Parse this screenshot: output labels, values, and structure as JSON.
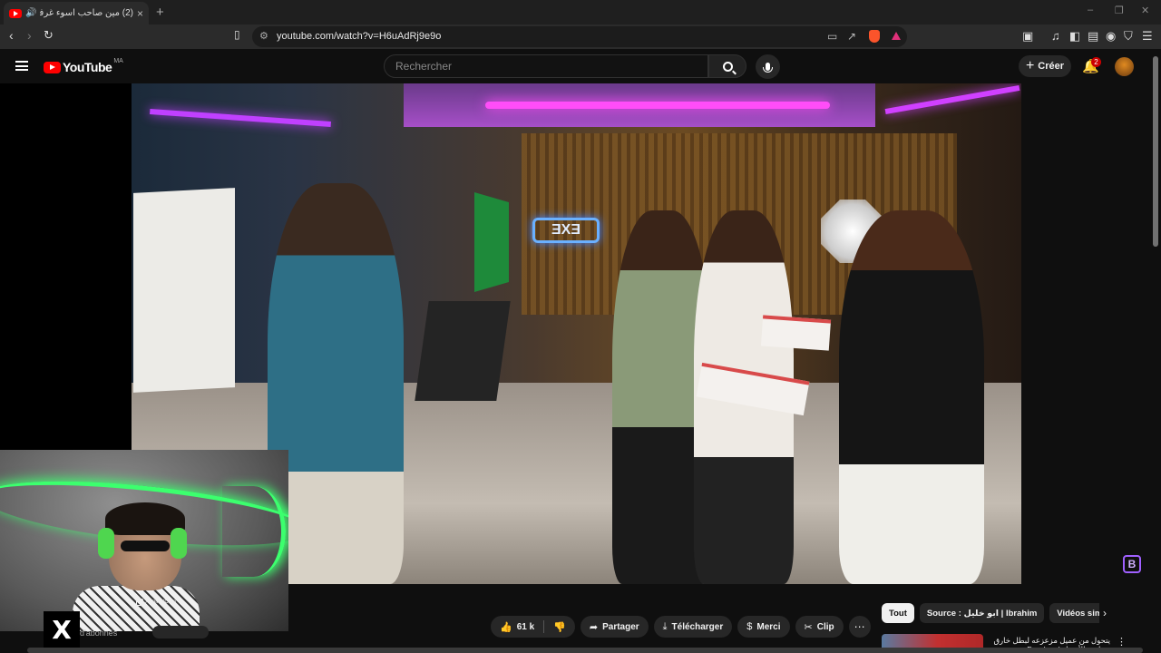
{
  "browser": {
    "tab_title": "(2) مين صاحب اسوء غرفة في",
    "new_tab": "+",
    "tab_close": "×",
    "url": "youtube.com/watch?v=H6uAdRj9e9o",
    "window_controls": [
      "–",
      "❐",
      "✕"
    ]
  },
  "youtube": {
    "logo_text": "YouTube",
    "country_code": "MA",
    "search_placeholder": "Rechercher",
    "create_label": "Créer",
    "notification_count": "2"
  },
  "webcam": {
    "label": "XSplit VCam",
    "subs_text": "d'abonnés"
  },
  "video": {
    "sign_text": "ƎXƎ"
  },
  "actions": {
    "likes": "61 k",
    "share": "Partager",
    "download": "Télécharger",
    "thanks": "Merci",
    "clip": "Clip"
  },
  "chips": {
    "all": "Tout",
    "source": "Source : ابو خليل | Ibrahim",
    "similar": "Vidéos similaires"
  },
  "suggested": {
    "title": "يتحول من عميل مزعزعه لبطل خارق بيحارب الأشرار Deadpool"
  },
  "colors": {
    "youtube_red": "#ff0000",
    "background": "#0f0f0f",
    "pill_bg": "#272727",
    "webcam_neon": "#3cff6e"
  }
}
